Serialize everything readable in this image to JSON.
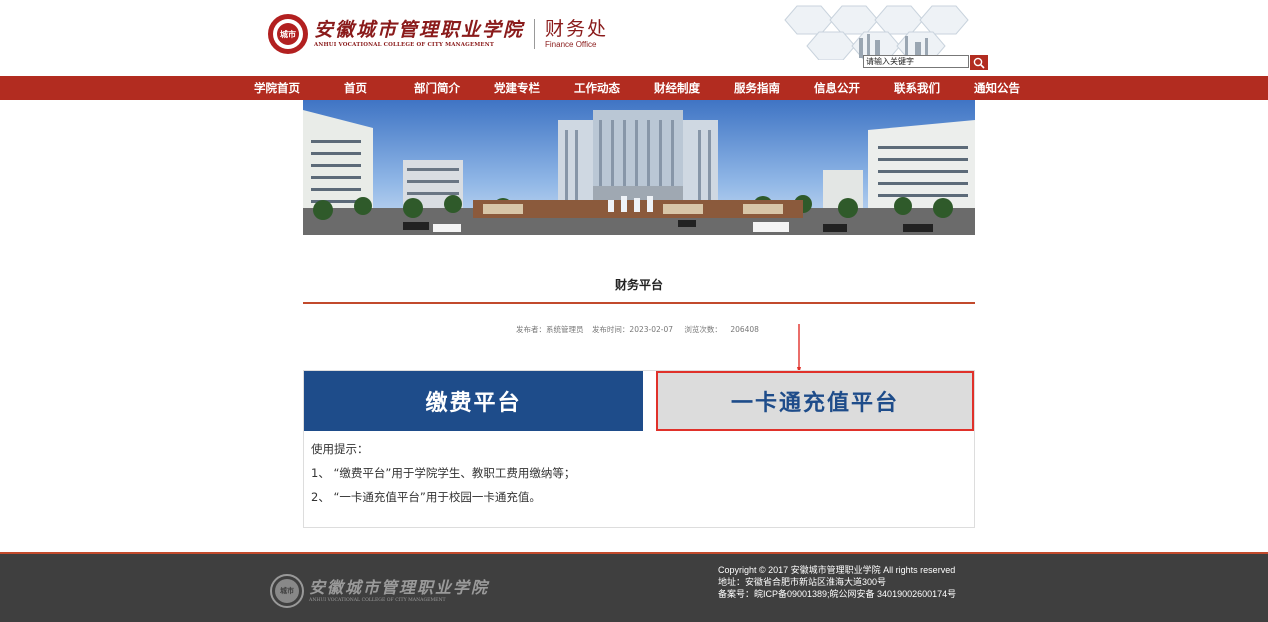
{
  "header": {
    "logo_seal_text": "城市",
    "college_name_cn": "安徽城市管理职业学院",
    "college_name_en": "ANHUI VOCATIONAL COLLEGE OF CITY MANAGEMENT",
    "office_cn": "财务处",
    "office_en": "Finance Office",
    "search_placeholder": "请输入关键字"
  },
  "nav": {
    "items": [
      {
        "label": "学院首页"
      },
      {
        "label": "首页"
      },
      {
        "label": "部门简介"
      },
      {
        "label": "党建专栏"
      },
      {
        "label": "工作动态"
      },
      {
        "label": "财经制度"
      },
      {
        "label": "服务指南"
      },
      {
        "label": "信息公开"
      },
      {
        "label": "联系我们"
      },
      {
        "label": "通知公告"
      }
    ]
  },
  "article": {
    "title": "财务平台",
    "author_label": "发布者：系统管理员",
    "date_label": "发布时间：2023-02-07",
    "views_label": "浏览次数：",
    "views_count": "206408"
  },
  "platforms": {
    "pay_label": "缴费平台",
    "card_label": "一卡通充值平台"
  },
  "tips": {
    "heading": "使用提示：",
    "line1": "1、 “缴费平台”用于学院学生、教职工费用缴纳等；",
    "line2": "2、 “一卡通充值平台”用于校园一卡通充值。"
  },
  "footer": {
    "seal_text": "城市",
    "college_name_cn": "安徽城市管理职业学院",
    "college_name_en": "ANHUI VOCATIONAL COLLEGE OF CITY MANAGEMENT",
    "copyright": "Copyright © 2017 安徽城市管理职业学院 All rights reserved",
    "address": "地址：安徽省合肥市新站区淮海大道300号",
    "icp": "备案号：皖ICP备09001389;皖公网安备 34019002600174号"
  },
  "colors": {
    "brand_red": "#b22c20",
    "pay_blue": "#1e4c8a",
    "highlight_red": "#e0312a",
    "footer_bg": "#3f3f3f"
  }
}
